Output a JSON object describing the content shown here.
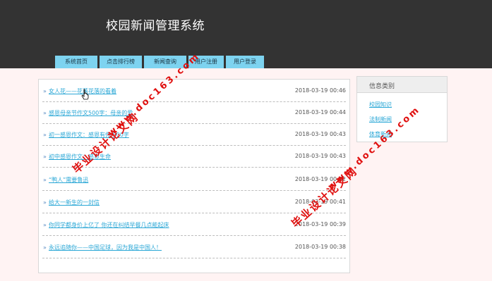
{
  "site": {
    "title": "校园新闻管理系统"
  },
  "nav": [
    {
      "label": "系统首页"
    },
    {
      "label": "点击排行榜"
    },
    {
      "label": "新闻查询"
    },
    {
      "label": "用户注册"
    },
    {
      "label": "用户登录"
    }
  ],
  "news": [
    {
      "title": "女人花——花落花落的看着",
      "date": "2018-03-19 00:46"
    },
    {
      "title": "感恩母亲节作文500字：母亲的爱",
      "date": "2018-03-19 00:44"
    },
    {
      "title": "初一感恩作文：感恩有你 500字",
      "date": "2018-03-19 00:43"
    },
    {
      "title": "初中感恩作文：感恩生命",
      "date": "2018-03-19 00:43"
    },
    {
      "title": "“鸭人”需要鲁迅",
      "date": "2018-03-19 00:42"
    },
    {
      "title": "给大一新生的一封信",
      "date": "2018-03-19 00:41"
    },
    {
      "title": "你同学都身价上亿了 你还在纠结早餐几点能起床",
      "date": "2018-03-19 00:39"
    },
    {
      "title": "永远追随你——中国足球，因为我是中国人！",
      "date": "2018-03-19 00:38"
    }
  ],
  "sidebar": {
    "heading": "信息类别",
    "links": [
      {
        "label": "校园知识"
      },
      {
        "label": "法制新闻"
      },
      {
        "label": "体育新闻"
      }
    ]
  },
  "watermarks": [
    {
      "text": "毕业设计论文网"
    },
    {
      "text": "www.doc163.com"
    },
    {
      "text": "毕业设计论文网"
    },
    {
      "text": "www.doc163.com"
    }
  ],
  "colors": {
    "header": "#333333",
    "nav": "#7dd3f0",
    "link": "#2aa7d6",
    "watermark": "#e0100f"
  }
}
